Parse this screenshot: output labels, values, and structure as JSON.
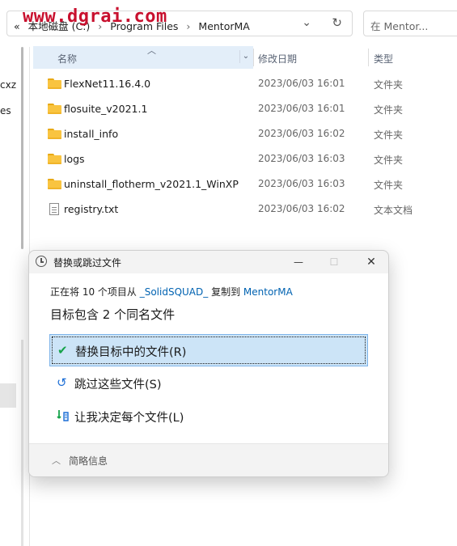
{
  "watermark": "www.dgrai.com",
  "address_bar": {
    "back_chevrons": "«",
    "crumbs": [
      "本地磁盘 (C:)",
      "Program Files",
      "MentorMA"
    ],
    "separator": "›",
    "dropdown_icon": "chevron-down-icon",
    "refresh_icon": "refresh-icon"
  },
  "search": {
    "placeholder": "在 Mentor..."
  },
  "nav_fragments": [
    "cxz",
    "es"
  ],
  "columns": {
    "name": "名称",
    "date": "修改日期",
    "type": "类型"
  },
  "files": [
    {
      "name": "FlexNet11.16.4.0",
      "date": "2023/06/03 16:01",
      "type": "文件夹",
      "kind": "folder"
    },
    {
      "name": "flosuite_v2021.1",
      "date": "2023/06/03 16:01",
      "type": "文件夹",
      "kind": "folder"
    },
    {
      "name": "install_info",
      "date": "2023/06/03 16:02",
      "type": "文件夹",
      "kind": "folder"
    },
    {
      "name": "logs",
      "date": "2023/06/03 16:03",
      "type": "文件夹",
      "kind": "folder"
    },
    {
      "name": "uninstall_flotherm_v2021.1_WinXP",
      "date": "2023/06/03 16:03",
      "type": "文件夹",
      "kind": "folder"
    },
    {
      "name": "registry.txt",
      "date": "2023/06/03 16:02",
      "type": "文本文档",
      "kind": "text"
    }
  ],
  "dialog": {
    "title": "替换或跳过文件",
    "status_prefix": "正在将 10 个项目从 ",
    "source": "_SolidSQUAD_",
    "status_mid": " 复制到 ",
    "destination": "MentorMA",
    "heading": "目标包含 2 个同名文件",
    "options": [
      {
        "label": "替换目标中的文件(R)",
        "icon": "checkmark-icon",
        "color": "#16a34a"
      },
      {
        "label": "跳过这些文件(S)",
        "icon": "skip-arrow-icon",
        "color": "#1d6fd6"
      },
      {
        "label": "让我决定每个文件(L)",
        "icon": "decide-icon",
        "color": "#16a34a"
      }
    ],
    "details_label": "简略信息",
    "controls": {
      "minimize": "—",
      "maximize": "☐",
      "close": "✕"
    }
  },
  "colors": {
    "accent": "#0062b1",
    "selection_bg": "#cce4f7",
    "folder": "#f9c440"
  }
}
